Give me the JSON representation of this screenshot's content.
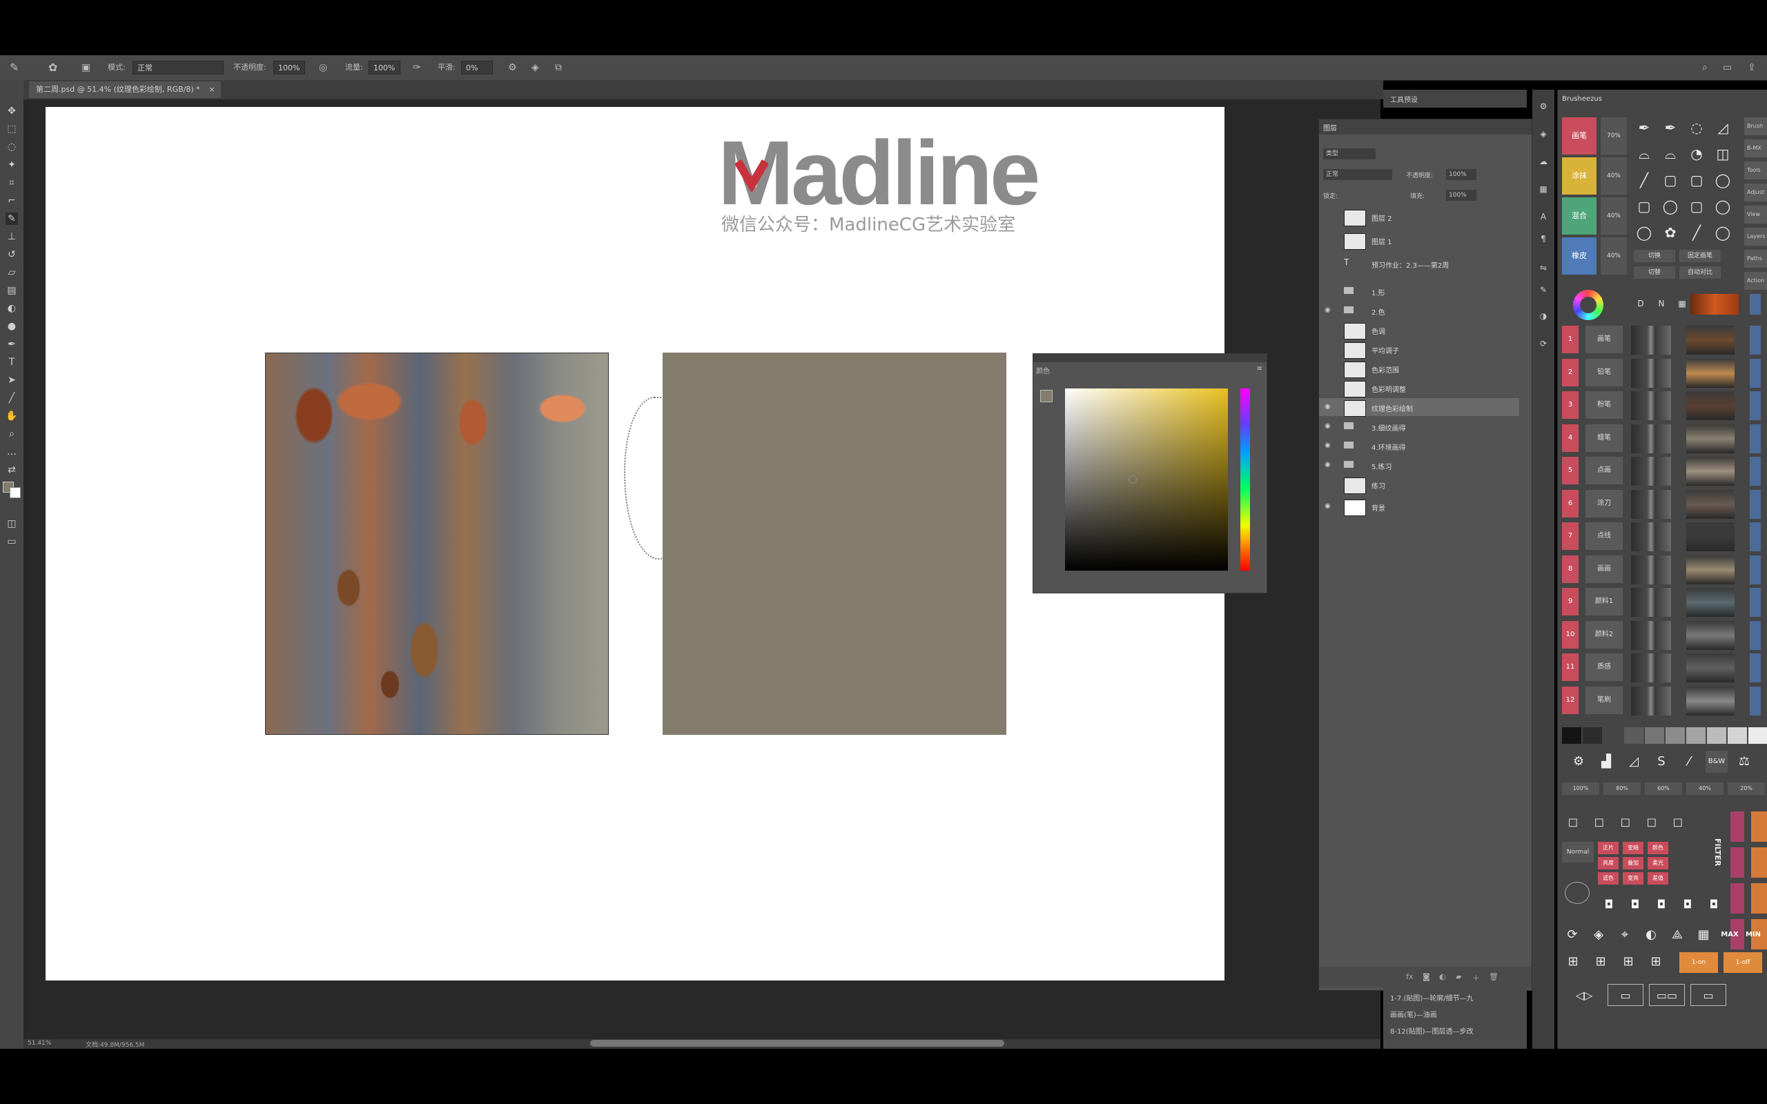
{
  "options_bar": {
    "mode_label": "模式:",
    "mode_value": "正常",
    "opacity_label": "不透明度:",
    "opacity_value": "100%",
    "flow_label": "流量:",
    "flow_value": "100%",
    "smooth_label": "平滑:",
    "smooth_value": "0%"
  },
  "document": {
    "tab_title": "第二周.psd @ 51.4% (纹理色彩绘制, RGB/8) *",
    "logo_text": "Madline",
    "logo_sub": "微信公众号：MadlineCG艺术实验室",
    "swatch_color": "#847c6c"
  },
  "picker": {
    "title": "颜色"
  },
  "panel_tab": "工具预设",
  "layers_panel": {
    "tab": "图层",
    "kind": "类型",
    "blend": "正常",
    "opacity_label": "不透明度:",
    "opacity": "100%",
    "lock_label": "锁定:",
    "fill_label": "填充:",
    "fill": "100%",
    "layers": [
      {
        "name": "图层 2",
        "type": "thumb",
        "visible": false
      },
      {
        "name": "图层 1",
        "type": "thumb",
        "visible": false
      },
      {
        "name": "预习作业：2.3——第2周",
        "type": "text",
        "visible": false
      },
      {
        "name": "1.形",
        "type": "folder",
        "visible": false
      },
      {
        "name": "2.色",
        "type": "folder",
        "visible": true
      },
      {
        "name": "色调",
        "type": "thumb",
        "visible": false
      },
      {
        "name": "平均调子",
        "type": "thumb",
        "visible": false
      },
      {
        "name": "色彩范围",
        "type": "thumb",
        "visible": false
      },
      {
        "name": "色彩明调整",
        "type": "thumb",
        "visible": false
      },
      {
        "name": "纹理色彩绘制",
        "type": "thumb",
        "visible": true,
        "selected": true
      },
      {
        "name": "3.细纹画得",
        "type": "folder",
        "visible": true
      },
      {
        "name": "4.环境画得",
        "type": "folder",
        "visible": true
      },
      {
        "name": "5.练习",
        "type": "folder",
        "visible": true
      },
      {
        "name": "练习",
        "type": "thumb",
        "visible": false
      },
      {
        "name": "背景",
        "type": "white",
        "visible": true
      }
    ]
  },
  "history": {
    "rows": [
      "1-7.(贴图)—轮廓/细节—九",
      "画画(笔)—油画",
      "8-12(贴图)—图层透—步改"
    ]
  },
  "brush_panel": {
    "title": "Brusheezus",
    "big_buttons": [
      "画笔",
      "涂抹",
      "混合",
      "橡皮"
    ],
    "big_colors": [
      "#c94d5c",
      "#d9b23a",
      "#4fa57a",
      "#4f7bb8"
    ],
    "percents": [
      "70%",
      "40%",
      "40%",
      "40%"
    ],
    "right_tabs": [
      "Brush",
      "B-MX",
      "Tools",
      "Adjust",
      "View",
      "Layers",
      "Paths",
      "Action"
    ],
    "mini_left": [
      "切换",
      "切替"
    ],
    "mini_right": [
      "固定画笔",
      "自动对比"
    ],
    "row_numbers": [
      "1",
      "2",
      "3",
      "4",
      "5",
      "6",
      "7",
      "8",
      "9",
      "10",
      "11",
      "12"
    ],
    "row_names": [
      "画笔",
      "铅笔",
      "粉笔",
      "蜡笔",
      "点画",
      "涂刀",
      "点线",
      "画画",
      "颜料1",
      "颜料2",
      "质感",
      "笔刷"
    ],
    "zoom_labels": [
      "100%",
      "80%",
      "60%",
      "40%",
      "20%"
    ],
    "filter_label": "FILTER",
    "normal_label": "Normal",
    "mm_labels": [
      "MAX",
      "MIN"
    ],
    "orange_labels": [
      "1-on",
      "1-off"
    ],
    "red_small": [
      "正片",
      "变暗",
      "颜色",
      "亮度",
      "叠加",
      "柔光",
      "滤色",
      "变亮",
      "差值"
    ]
  },
  "status": {
    "zoom": "51.41%",
    "doc": "文档:49.8M/956.5M"
  }
}
